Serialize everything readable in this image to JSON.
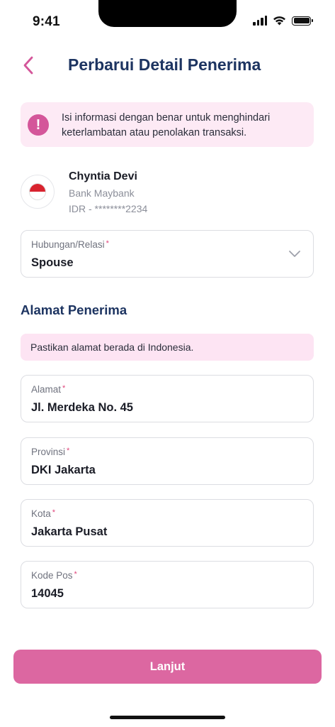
{
  "status_bar": {
    "time": "9:41"
  },
  "header": {
    "title": "Perbarui Detail Penerima"
  },
  "warning": {
    "text": "Isi informasi dengan benar untuk menghindari keterlambatan atau penolakan transaksi.",
    "icon": "exclamation-icon"
  },
  "recipient": {
    "name": "Chyntia Devi",
    "bank": "Bank Maybank",
    "account": "IDR - ********2234",
    "flag": "indonesia-flag"
  },
  "relation": {
    "label": "Hubungan/Relasi",
    "value": "Spouse"
  },
  "address_section": {
    "title": "Alamat Penerima",
    "info": "Pastikan alamat berada di Indonesia."
  },
  "fields": {
    "alamat": {
      "label": "Alamat",
      "value": "Jl. Merdeka No. 45"
    },
    "provinsi": {
      "label": "Provinsi",
      "value": "DKI Jakarta"
    },
    "kota": {
      "label": "Kota",
      "value": "Jakarta Pusat"
    },
    "kode_pos": {
      "label": "Kode Pos",
      "value": "14045"
    }
  },
  "required_marker": "*",
  "cta": {
    "label": "Lanjut"
  },
  "colors": {
    "brand_pink": "#dc67a1",
    "title_navy": "#1d3461",
    "warning_bg": "#fdeaf5"
  }
}
